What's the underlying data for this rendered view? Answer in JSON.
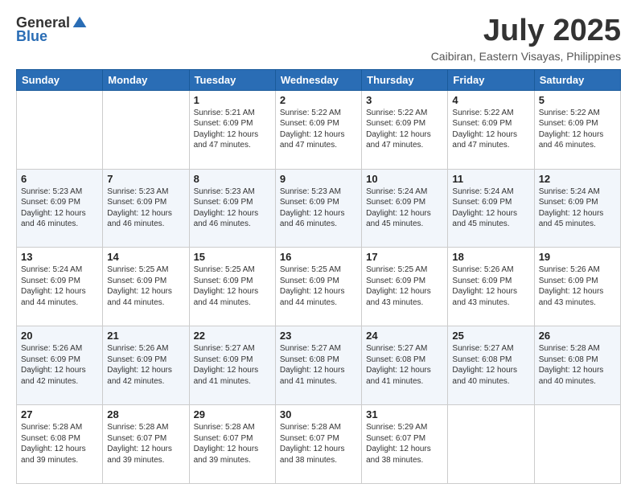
{
  "header": {
    "logo_general": "General",
    "logo_blue": "Blue",
    "title": "July 2025",
    "subtitle": "Caibiran, Eastern Visayas, Philippines"
  },
  "days_of_week": [
    "Sunday",
    "Monday",
    "Tuesday",
    "Wednesday",
    "Thursday",
    "Friday",
    "Saturday"
  ],
  "weeks": [
    [
      {
        "day": "",
        "sunrise": "",
        "sunset": "",
        "daylight": ""
      },
      {
        "day": "",
        "sunrise": "",
        "sunset": "",
        "daylight": ""
      },
      {
        "day": "1",
        "sunrise": "Sunrise: 5:21 AM",
        "sunset": "Sunset: 6:09 PM",
        "daylight": "Daylight: 12 hours and 47 minutes."
      },
      {
        "day": "2",
        "sunrise": "Sunrise: 5:22 AM",
        "sunset": "Sunset: 6:09 PM",
        "daylight": "Daylight: 12 hours and 47 minutes."
      },
      {
        "day": "3",
        "sunrise": "Sunrise: 5:22 AM",
        "sunset": "Sunset: 6:09 PM",
        "daylight": "Daylight: 12 hours and 47 minutes."
      },
      {
        "day": "4",
        "sunrise": "Sunrise: 5:22 AM",
        "sunset": "Sunset: 6:09 PM",
        "daylight": "Daylight: 12 hours and 47 minutes."
      },
      {
        "day": "5",
        "sunrise": "Sunrise: 5:22 AM",
        "sunset": "Sunset: 6:09 PM",
        "daylight": "Daylight: 12 hours and 46 minutes."
      }
    ],
    [
      {
        "day": "6",
        "sunrise": "Sunrise: 5:23 AM",
        "sunset": "Sunset: 6:09 PM",
        "daylight": "Daylight: 12 hours and 46 minutes."
      },
      {
        "day": "7",
        "sunrise": "Sunrise: 5:23 AM",
        "sunset": "Sunset: 6:09 PM",
        "daylight": "Daylight: 12 hours and 46 minutes."
      },
      {
        "day": "8",
        "sunrise": "Sunrise: 5:23 AM",
        "sunset": "Sunset: 6:09 PM",
        "daylight": "Daylight: 12 hours and 46 minutes."
      },
      {
        "day": "9",
        "sunrise": "Sunrise: 5:23 AM",
        "sunset": "Sunset: 6:09 PM",
        "daylight": "Daylight: 12 hours and 46 minutes."
      },
      {
        "day": "10",
        "sunrise": "Sunrise: 5:24 AM",
        "sunset": "Sunset: 6:09 PM",
        "daylight": "Daylight: 12 hours and 45 minutes."
      },
      {
        "day": "11",
        "sunrise": "Sunrise: 5:24 AM",
        "sunset": "Sunset: 6:09 PM",
        "daylight": "Daylight: 12 hours and 45 minutes."
      },
      {
        "day": "12",
        "sunrise": "Sunrise: 5:24 AM",
        "sunset": "Sunset: 6:09 PM",
        "daylight": "Daylight: 12 hours and 45 minutes."
      }
    ],
    [
      {
        "day": "13",
        "sunrise": "Sunrise: 5:24 AM",
        "sunset": "Sunset: 6:09 PM",
        "daylight": "Daylight: 12 hours and 44 minutes."
      },
      {
        "day": "14",
        "sunrise": "Sunrise: 5:25 AM",
        "sunset": "Sunset: 6:09 PM",
        "daylight": "Daylight: 12 hours and 44 minutes."
      },
      {
        "day": "15",
        "sunrise": "Sunrise: 5:25 AM",
        "sunset": "Sunset: 6:09 PM",
        "daylight": "Daylight: 12 hours and 44 minutes."
      },
      {
        "day": "16",
        "sunrise": "Sunrise: 5:25 AM",
        "sunset": "Sunset: 6:09 PM",
        "daylight": "Daylight: 12 hours and 44 minutes."
      },
      {
        "day": "17",
        "sunrise": "Sunrise: 5:25 AM",
        "sunset": "Sunset: 6:09 PM",
        "daylight": "Daylight: 12 hours and 43 minutes."
      },
      {
        "day": "18",
        "sunrise": "Sunrise: 5:26 AM",
        "sunset": "Sunset: 6:09 PM",
        "daylight": "Daylight: 12 hours and 43 minutes."
      },
      {
        "day": "19",
        "sunrise": "Sunrise: 5:26 AM",
        "sunset": "Sunset: 6:09 PM",
        "daylight": "Daylight: 12 hours and 43 minutes."
      }
    ],
    [
      {
        "day": "20",
        "sunrise": "Sunrise: 5:26 AM",
        "sunset": "Sunset: 6:09 PM",
        "daylight": "Daylight: 12 hours and 42 minutes."
      },
      {
        "day": "21",
        "sunrise": "Sunrise: 5:26 AM",
        "sunset": "Sunset: 6:09 PM",
        "daylight": "Daylight: 12 hours and 42 minutes."
      },
      {
        "day": "22",
        "sunrise": "Sunrise: 5:27 AM",
        "sunset": "Sunset: 6:09 PM",
        "daylight": "Daylight: 12 hours and 41 minutes."
      },
      {
        "day": "23",
        "sunrise": "Sunrise: 5:27 AM",
        "sunset": "Sunset: 6:08 PM",
        "daylight": "Daylight: 12 hours and 41 minutes."
      },
      {
        "day": "24",
        "sunrise": "Sunrise: 5:27 AM",
        "sunset": "Sunset: 6:08 PM",
        "daylight": "Daylight: 12 hours and 41 minutes."
      },
      {
        "day": "25",
        "sunrise": "Sunrise: 5:27 AM",
        "sunset": "Sunset: 6:08 PM",
        "daylight": "Daylight: 12 hours and 40 minutes."
      },
      {
        "day": "26",
        "sunrise": "Sunrise: 5:28 AM",
        "sunset": "Sunset: 6:08 PM",
        "daylight": "Daylight: 12 hours and 40 minutes."
      }
    ],
    [
      {
        "day": "27",
        "sunrise": "Sunrise: 5:28 AM",
        "sunset": "Sunset: 6:08 PM",
        "daylight": "Daylight: 12 hours and 39 minutes."
      },
      {
        "day": "28",
        "sunrise": "Sunrise: 5:28 AM",
        "sunset": "Sunset: 6:07 PM",
        "daylight": "Daylight: 12 hours and 39 minutes."
      },
      {
        "day": "29",
        "sunrise": "Sunrise: 5:28 AM",
        "sunset": "Sunset: 6:07 PM",
        "daylight": "Daylight: 12 hours and 39 minutes."
      },
      {
        "day": "30",
        "sunrise": "Sunrise: 5:28 AM",
        "sunset": "Sunset: 6:07 PM",
        "daylight": "Daylight: 12 hours and 38 minutes."
      },
      {
        "day": "31",
        "sunrise": "Sunrise: 5:29 AM",
        "sunset": "Sunset: 6:07 PM",
        "daylight": "Daylight: 12 hours and 38 minutes."
      },
      {
        "day": "",
        "sunrise": "",
        "sunset": "",
        "daylight": ""
      },
      {
        "day": "",
        "sunrise": "",
        "sunset": "",
        "daylight": ""
      }
    ]
  ]
}
